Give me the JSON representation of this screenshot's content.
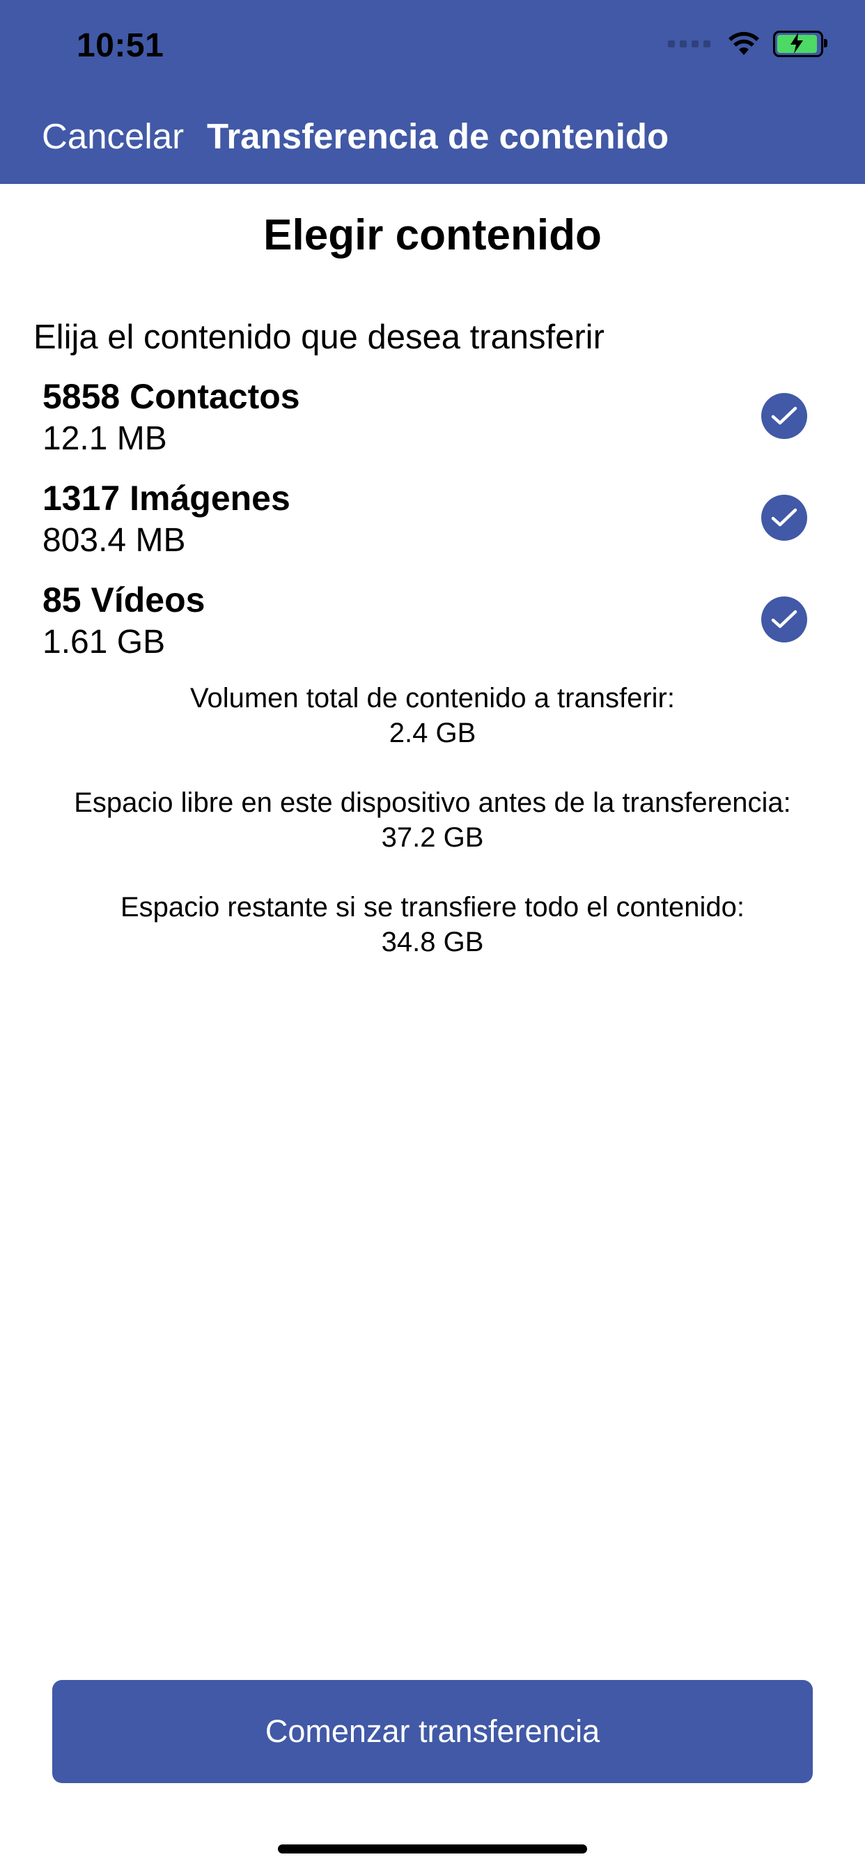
{
  "status_bar": {
    "time": "10:51"
  },
  "nav": {
    "cancel": "Cancelar",
    "title": "Transferencia de contenido"
  },
  "page": {
    "title": "Elegir contenido",
    "subtitle": "Elija el contenido que desea transferir"
  },
  "items": [
    {
      "title": "5858 Contactos",
      "size": "12.1 MB",
      "selected": true
    },
    {
      "title": "1317 Imágenes",
      "size": "803.4 MB",
      "selected": true
    },
    {
      "title": "85 Vídeos",
      "size": "1.61 GB",
      "selected": true
    }
  ],
  "summary": {
    "total_label": "Volumen total de contenido a transferir:",
    "total_value": "2.4 GB",
    "free_label": "Espacio libre en este dispositivo antes de la transferencia:",
    "free_value": "37.2 GB",
    "remaining_label": "Espacio restante si se transfiere todo el contenido:",
    "remaining_value": "34.8 GB"
  },
  "cta": {
    "label": "Comenzar transferencia"
  },
  "colors": {
    "accent": "#4159a6"
  }
}
